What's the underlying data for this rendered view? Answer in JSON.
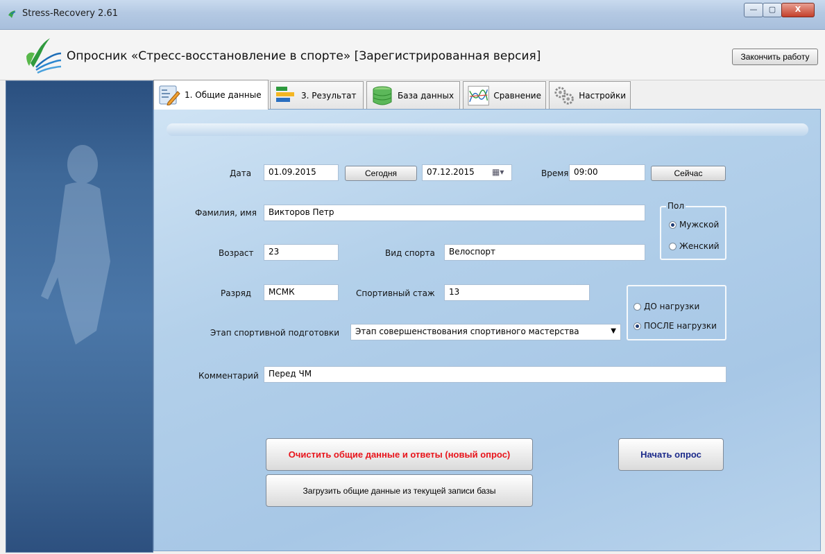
{
  "window": {
    "title": "Stress-Recovery 2.61",
    "controls": {
      "minimize": "—",
      "maximize": "▢",
      "close": "X"
    }
  },
  "header": {
    "heading": "Опросник «Стресс-восстановление в спорте» [Зарегистрированная версия]",
    "finish_button": "Закончить работу"
  },
  "tabs": [
    {
      "label": "1. Общие данные",
      "icon": "form-edit-icon",
      "active": true
    },
    {
      "label": "3. Результат",
      "icon": "bar-chart-icon",
      "active": false
    },
    {
      "label": "База данных",
      "icon": "database-icon",
      "active": false
    },
    {
      "label": "Сравнение",
      "icon": "line-chart-icon",
      "active": false
    },
    {
      "label": "Настройки",
      "icon": "gears-icon",
      "active": false
    }
  ],
  "form": {
    "date_label": "Дата",
    "date_value": "01.09.2015",
    "today_button": "Сегодня",
    "picker_date": "07.12.2015",
    "time_label": "Время",
    "time_value": "09:00",
    "now_button": "Сейчас",
    "name_label": "Фамилия, имя",
    "name_value": "Викторов Петр",
    "age_label": "Возраст",
    "age_value": "23",
    "sport_label": "Вид спорта",
    "sport_value": "Велоспорт",
    "rank_label": "Разряд",
    "rank_value": "МСМК",
    "experience_label": "Спортивный стаж",
    "experience_value": "13",
    "stage_label": "Этап спортивной подготовки",
    "stage_value": "Этап совершенствования спортивного мастерства",
    "comment_label": "Комментарий",
    "comment_value": "Перед ЧМ"
  },
  "gender": {
    "legend": "Пол",
    "options": [
      {
        "label": "Мужской",
        "selected": true
      },
      {
        "label": "Женский",
        "selected": false
      }
    ]
  },
  "load": {
    "options": [
      {
        "label": "ДО нагрузки",
        "selected": false
      },
      {
        "label": "ПОСЛЕ нагрузки",
        "selected": true
      }
    ]
  },
  "actions": {
    "clear_button": "Очистить общие данные и ответы (новый опрос)",
    "load_button": "Загрузить общие данные из текущей записи базы",
    "start_button": "Начать опрос"
  },
  "colors": {
    "clear_text": "#e8141b",
    "start_text": "#1b2a8a",
    "panel_bg": "#a7c7e6"
  }
}
